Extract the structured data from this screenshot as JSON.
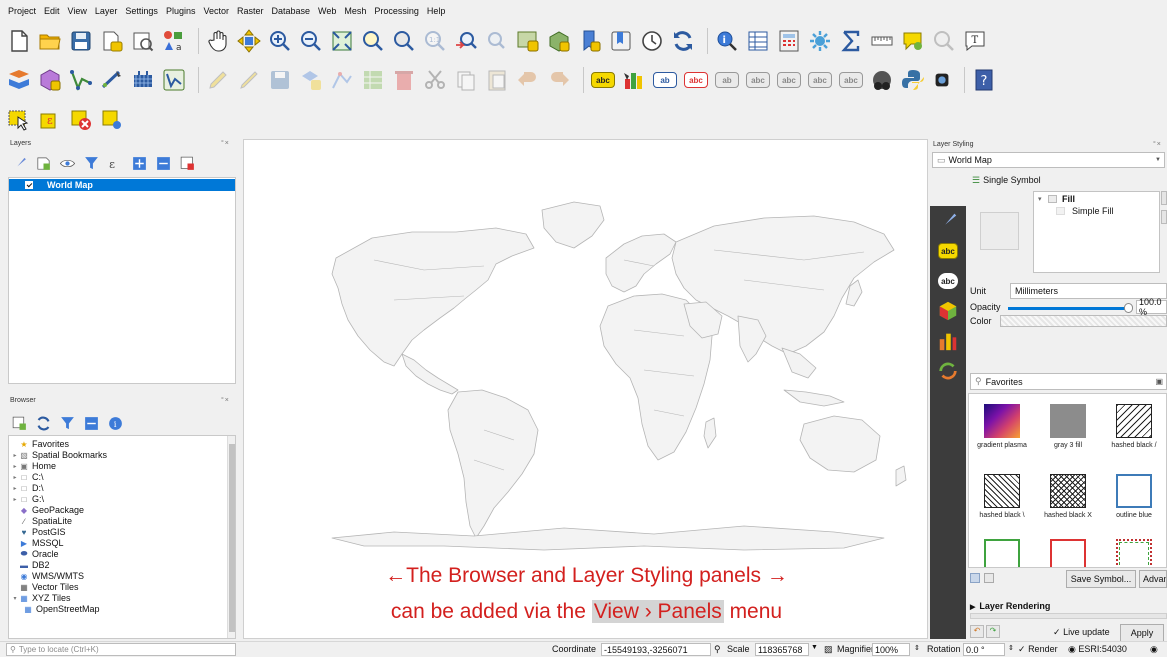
{
  "menubar": {
    "items": [
      "Project",
      "Edit",
      "View",
      "Layer",
      "Settings",
      "Plugins",
      "Vector",
      "Raster",
      "Database",
      "Web",
      "Mesh",
      "Processing",
      "Help"
    ]
  },
  "colors": {
    "accent": "#0078d7",
    "caption": "#d3201e",
    "style_sidebar": "#3c3c3c",
    "map_fill": "#f3f3f3",
    "map_border": "#b5b5b5"
  },
  "layers_panel": {
    "title": "Layers",
    "controls": "°×",
    "items": [
      {
        "name": "World Map",
        "checked": true,
        "selected": true
      }
    ]
  },
  "browser_panel": {
    "title": "Browser",
    "controls": "°×",
    "items": [
      {
        "label": "Favorites",
        "icon": "star-icon"
      },
      {
        "label": "Spatial Bookmarks",
        "icon": "bookmark-icon"
      },
      {
        "label": "Home",
        "icon": "home-folder-icon"
      },
      {
        "label": "C:\\",
        "icon": "drive-icon"
      },
      {
        "label": "D:\\",
        "icon": "drive-icon"
      },
      {
        "label": "G:\\",
        "icon": "drive-icon"
      },
      {
        "label": "GeoPackage",
        "icon": "geopackage-icon"
      },
      {
        "label": "SpatiaLite",
        "icon": "spatialite-icon"
      },
      {
        "label": "PostGIS",
        "icon": "postgis-icon"
      },
      {
        "label": "MSSQL",
        "icon": "mssql-icon"
      },
      {
        "label": "Oracle",
        "icon": "oracle-icon"
      },
      {
        "label": "DB2",
        "icon": "db2-icon"
      },
      {
        "label": "WMS/WMTS",
        "icon": "wms-icon"
      },
      {
        "label": "Vector Tiles",
        "icon": "vector-tiles-icon"
      },
      {
        "label": "XYZ Tiles",
        "icon": "xyz-tiles-icon"
      },
      {
        "label": "OpenStreetMap",
        "icon": "xyz-tiles-icon"
      }
    ]
  },
  "map": {
    "caption_line1": "←The Browser and Layer Styling panels →",
    "caption_line2_pre": "can be added via the ",
    "caption_line2_highlight": "View › Panels",
    "caption_line2_post": " menu"
  },
  "styling_panel": {
    "title": "Layer Styling",
    "controls": "°×",
    "layer": "World Map",
    "renderer": "Single Symbol",
    "tree_root": "Fill",
    "tree_child": "Simple Fill",
    "unit_label": "Unit",
    "unit_value": "Millimeters",
    "opacity_label": "Opacity",
    "opacity_value": "100.0 %",
    "opacity_fraction": 1.0,
    "color_label": "Color",
    "search_placeholder": "Favorites",
    "symbols": [
      {
        "label": "gradient plasma"
      },
      {
        "label": "gray 3 fill"
      },
      {
        "label": "hashed black /"
      },
      {
        "label": "hashed black \\"
      },
      {
        "label": "hashed black X"
      },
      {
        "label": "outline blue"
      },
      {
        "label": ""
      },
      {
        "label": ""
      },
      {
        "label": ""
      }
    ],
    "save_symbol": "Save Symbol...",
    "advanced": "Advanced",
    "layer_rendering": "Layer Rendering",
    "live_update": "Live update",
    "apply": "Apply"
  },
  "statusbar": {
    "locator_placeholder": "Type to locate (Ctrl+K)",
    "coordinate_label": "Coordinate",
    "coordinate_value": "-15549193,-3256071",
    "scale_label": "Scale",
    "scale_value": "118365768",
    "magnifier_label": "Magnifier",
    "magnifier_value": "100%",
    "rotation_label": "Rotation",
    "rotation_value": "0.0 °",
    "render_label": "Render",
    "crs": "ESRI:54030"
  }
}
